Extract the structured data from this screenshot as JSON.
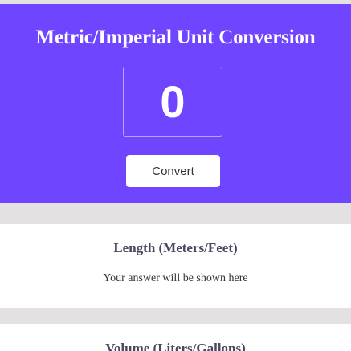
{
  "header": {
    "title": "Metric/Imperial Unit Conversion",
    "input_value": "0",
    "convert_label": "Convert"
  },
  "sections": [
    {
      "title": "Length (Meters/Feet)",
      "result": "Your answer will be shown here"
    },
    {
      "title": "Volume (Liters/Gallons)"
    }
  ],
  "colors": {
    "accent": "#6f45ff",
    "background": "#e3e1e1",
    "card": "#ffffff",
    "section_title": "#474761"
  }
}
